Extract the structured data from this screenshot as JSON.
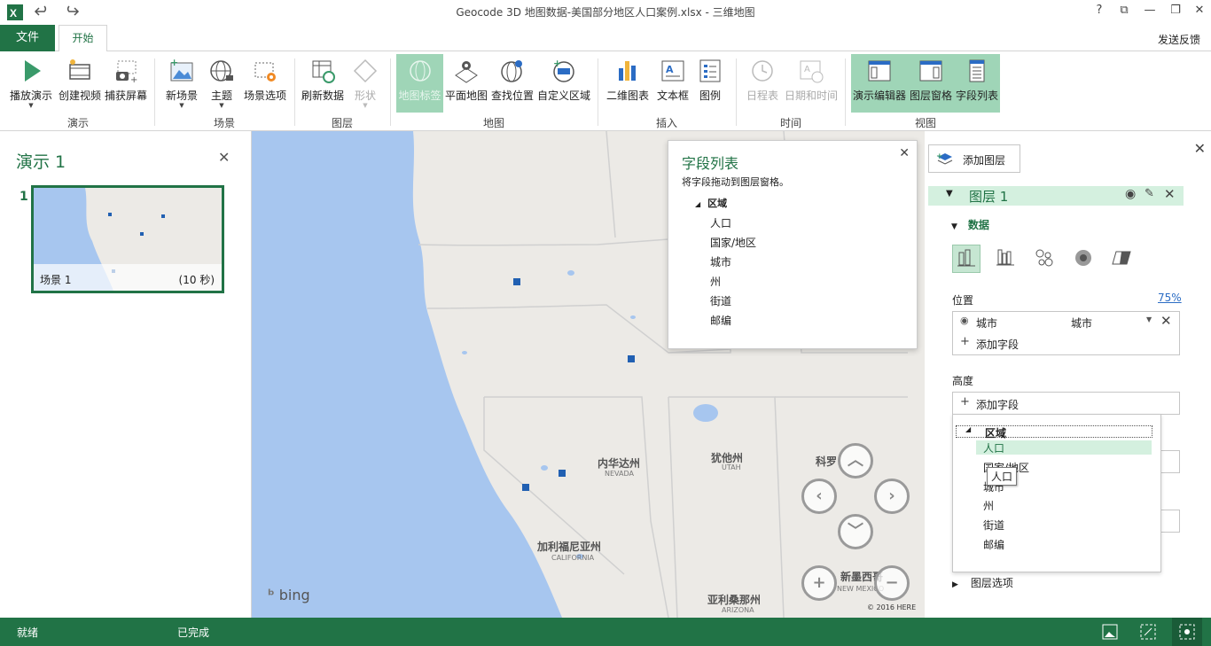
{
  "window": {
    "title": "Geocode 3D 地图数据-美国部分地区人口案例.xlsx - 三维地图",
    "help": "?",
    "restore": "⧉",
    "minimize": "—",
    "maximize": "❐",
    "close": "✕"
  },
  "tabs": {
    "file": "文件",
    "home": "开始",
    "feedback": "发送反馈"
  },
  "ribbon": {
    "groups": {
      "tour": "演示",
      "scene": "场景",
      "layer": "图层",
      "map": "地图",
      "insert": "插入",
      "time": "时间",
      "view": "视图"
    },
    "buttons": {
      "play_tour": "播放演示",
      "create_video": "创建视频",
      "capture_screen": "捕获屏幕",
      "new_scene": "新场景",
      "theme": "主题",
      "scene_options": "场景选项",
      "refresh_data": "刷新数据",
      "shapes": "形状",
      "map_labels": "地图标签",
      "flat_map": "平面地图",
      "find_location": "查找位置",
      "custom_regions": "自定义区域",
      "chart_2d": "二维图表",
      "text_box": "文本框",
      "legend": "图例",
      "timeline": "日程表",
      "date_time": "日期和时间",
      "tour_editor": "演示编辑器",
      "layer_pane": "图层窗格",
      "field_list": "字段列表"
    }
  },
  "tour_panel": {
    "title": "演示 1",
    "scene_number": "1",
    "scene_name": "场景 1",
    "scene_duration": "(10 秒)"
  },
  "map": {
    "labels": {
      "nevada": "内华达州",
      "nevada_en": "NEVADA",
      "utah": "犹他州",
      "utah_en": "UTAH",
      "colorado": "科罗",
      "california": "加利福尼亚州",
      "california_en": "CALIFORNIA",
      "arizona": "亚利桑那州",
      "arizona_en": "ARIZONA",
      "new_mexico": "新墨西哥",
      "new_mexico_en": "NEW MEXICO"
    },
    "bing": "bing",
    "copyright": "© 2016 HERE"
  },
  "field_list_popup": {
    "title": "字段列表",
    "subtitle": "将字段拖动到图层窗格。",
    "table": "区域",
    "fields": [
      "人口",
      "国家/地区",
      "城市",
      "州",
      "街道",
      "邮编"
    ]
  },
  "layer_pane": {
    "add_layer": "添加图层",
    "layer_name": "图层 1",
    "data_section": "数据",
    "location_label": "位置",
    "location_percent": "75%",
    "location_field": "城市",
    "location_type": "城市",
    "add_field": "添加字段",
    "height_label": "高度",
    "height_add_field": "添加字段",
    "layer_options": "图层选项",
    "dropdown": {
      "table": "区域",
      "items": [
        "人口",
        "国家/地区",
        "城市",
        "州",
        "街道",
        "邮编"
      ],
      "selected": "人口",
      "tooltip": "人口"
    }
  },
  "status": {
    "ready": "就绪",
    "done": "已完成"
  },
  "colors": {
    "accent": "#217346",
    "selected": "#d4f0df",
    "water": "#a7c6ef",
    "land": "#eceae6",
    "marker": "#2160b2"
  }
}
